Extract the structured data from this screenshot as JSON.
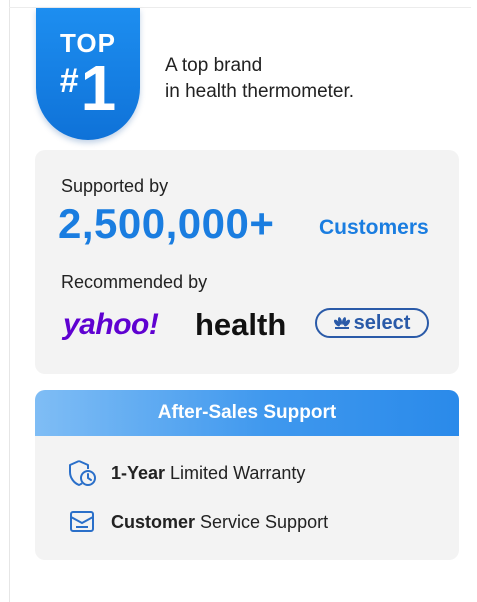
{
  "badge": {
    "line1": "TOP",
    "hash": "#",
    "number": "1"
  },
  "brand": {
    "line1": "A top brand",
    "line2": "in health thermometer."
  },
  "support": {
    "supported_by": "Supported by",
    "count": "2,500,000+",
    "customers": "Customers",
    "recommended_by": "Recommended by",
    "logos": {
      "yahoo": "yahoo!",
      "health": "health",
      "select": "select"
    }
  },
  "after_sales": {
    "title": "After-Sales Support",
    "warranty_strong": "1-Year",
    "warranty_rest": " Limited Warranty",
    "service_strong": "Customer",
    "service_rest": " Service Support"
  },
  "colors": {
    "accent": "#1a7de0",
    "badge": "#0f72d8",
    "yahoo": "#5f01d1",
    "select": "#2a5aa8",
    "card": "#f3f3f3"
  },
  "icons": [
    "shield-clock-icon",
    "support-document-icon",
    "nbc-peacock-icon"
  ]
}
